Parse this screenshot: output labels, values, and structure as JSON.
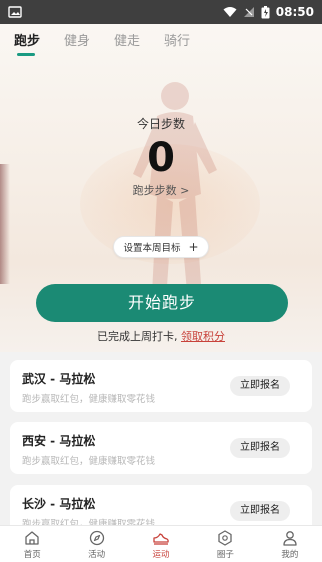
{
  "status_bar": {
    "time": "08:50",
    "icons": [
      "image-icon",
      "wifi-icon",
      "signal-icon",
      "battery-icon"
    ]
  },
  "tabs": [
    {
      "label": "跑步",
      "active": true
    },
    {
      "label": "健身",
      "active": false
    },
    {
      "label": "健走",
      "active": false
    },
    {
      "label": "骑行",
      "active": false
    }
  ],
  "steps": {
    "title": "今日步数",
    "count": "0",
    "link": "跑步步数 >"
  },
  "goal_button": {
    "label": "设置本周目标",
    "icon": "+"
  },
  "start_button": {
    "label": "开始跑步"
  },
  "checkin": {
    "text": "已完成上周打卡, ",
    "link": "领取积分"
  },
  "marathons": [
    {
      "name": "武汉 - 马拉松",
      "desc": "跑步赢取红包，健康赚取零花钱",
      "action": "立即报名"
    },
    {
      "name": "西安 - 马拉松",
      "desc": "跑步赢取红包，健康赚取零花钱",
      "action": "立即报名"
    },
    {
      "name": "长沙 - 马拉松",
      "desc": "跑步赢取红包，健康赚取零花钱",
      "action": "立即报名"
    }
  ],
  "bottom_nav": [
    {
      "label": "首页",
      "icon": "home-icon",
      "active": false
    },
    {
      "label": "活动",
      "icon": "compass-icon",
      "active": false
    },
    {
      "label": "运动",
      "icon": "shoe-icon",
      "active": true
    },
    {
      "label": "圈子",
      "icon": "circle-hexagon-icon",
      "active": false
    },
    {
      "label": "我的",
      "icon": "user-icon",
      "active": false
    }
  ],
  "colors": {
    "accent": "#1b8a74",
    "tab_indicator": "#1a9a82",
    "active_nav": "#c8423b",
    "link": "#c8423b"
  }
}
